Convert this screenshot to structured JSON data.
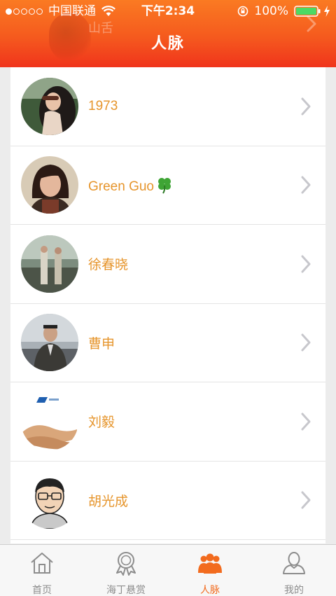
{
  "status_bar": {
    "carrier": "中国联通",
    "time": "下午2:34",
    "battery": "100%"
  },
  "header": {
    "title": "人脉",
    "ghost_label": "山舌"
  },
  "contacts": [
    {
      "name": "1973"
    },
    {
      "name": "Green Guo"
    },
    {
      "name": "徐春晓"
    },
    {
      "name": "曹申"
    },
    {
      "name": "刘毅"
    },
    {
      "name": "胡光成"
    }
  ],
  "tabs": [
    {
      "label": "首页",
      "icon": "home-icon",
      "active": false
    },
    {
      "label": "海丁悬赏",
      "icon": "medal-icon",
      "active": false
    },
    {
      "label": "人脉",
      "icon": "people-icon",
      "active": true
    },
    {
      "label": "我的",
      "icon": "person-icon",
      "active": false
    }
  ],
  "colors": {
    "accent": "#f26b1e",
    "name_text": "#e6952c",
    "header_top": "#fa7a22",
    "header_bottom": "#f0341c"
  }
}
